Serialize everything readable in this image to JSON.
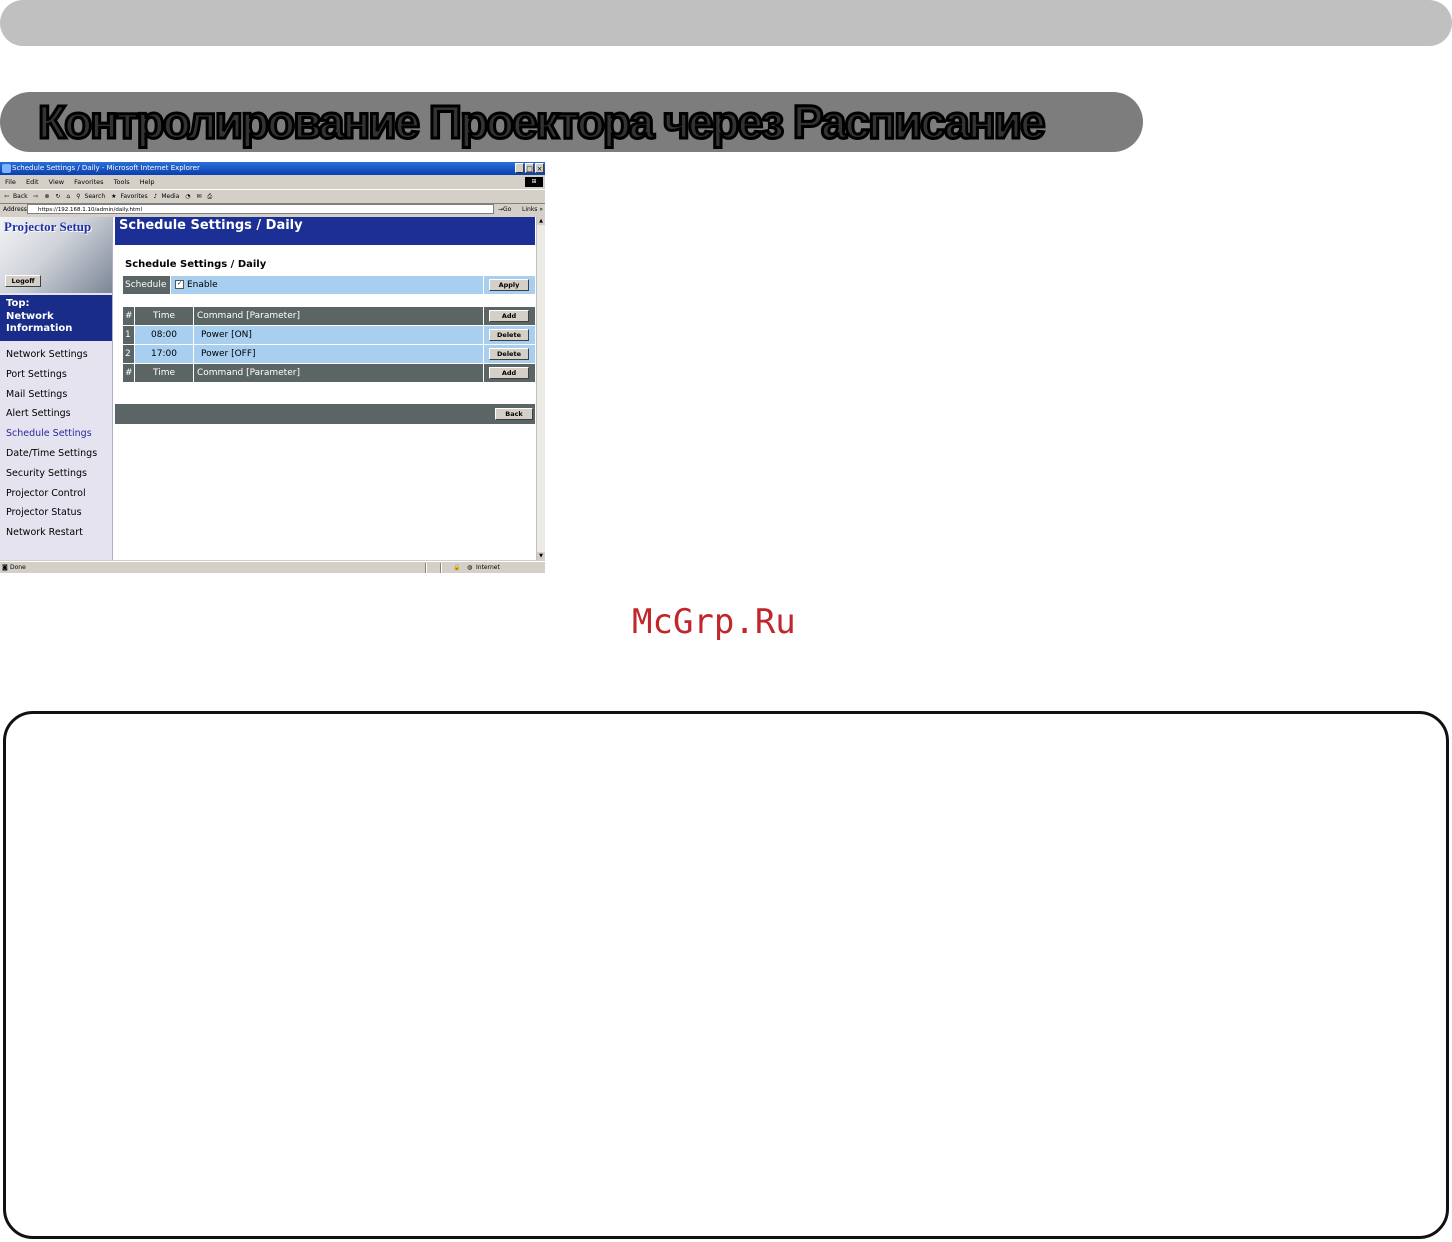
{
  "heading": "Контролирование Проектора через Расписание",
  "watermark": "McGrp.Ru",
  "browser": {
    "title": "Schedule Settings / Daily - Microsoft Internet Explorer",
    "menu": [
      "File",
      "Edit",
      "View",
      "Favorites",
      "Tools",
      "Help"
    ],
    "toolbar": [
      "Back",
      "Search",
      "Favorites",
      "Media"
    ],
    "address_label": "Address",
    "address_value": "https://192.168.1.10/admin/daily.html",
    "go_label": "Go",
    "links_label": "Links",
    "status_text": "Done",
    "zone_text": "Internet"
  },
  "sidebar": {
    "logo": "Projector Setup",
    "logoff": "Logoff",
    "top_lines": [
      "Top:",
      "Network",
      "Information"
    ],
    "items": [
      {
        "label": "Network Settings"
      },
      {
        "label": "Port Settings"
      },
      {
        "label": "Mail Settings"
      },
      {
        "label": "Alert Settings"
      },
      {
        "label": "Schedule Settings"
      },
      {
        "label": "Date/Time Settings"
      },
      {
        "label": "Security Settings"
      },
      {
        "label": "Projector Control"
      },
      {
        "label": "Projector Status"
      },
      {
        "label": "Network Restart"
      }
    ]
  },
  "main": {
    "header": "Schedule Settings / Daily",
    "subtitle": "Schedule Settings / Daily",
    "schedule_label": "Schedule",
    "enable_label": "Enable",
    "enable_checked": true,
    "apply_label": "Apply",
    "table_header": {
      "num": "#",
      "time": "Time",
      "command": "Command [Parameter]",
      "action": "Add"
    },
    "rows": [
      {
        "num": "1",
        "time": "08:00",
        "command": "Power [ON]",
        "action": "Delete"
      },
      {
        "num": "2",
        "time": "17:00",
        "command": "Power [OFF]",
        "action": "Delete"
      }
    ],
    "back_label": "Back"
  }
}
